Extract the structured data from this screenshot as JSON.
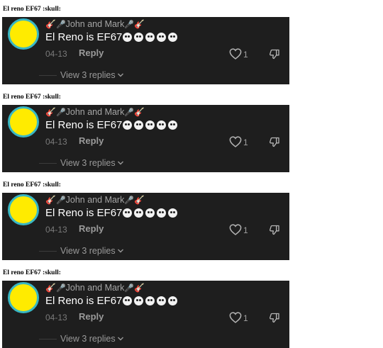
{
  "caption": "El reno EF67 :skull:",
  "comment": {
    "author_prefix_emoji": "🎸",
    "author_prefix_mic": "🎤",
    "author": "John and Mark",
    "author_suffix_mic": "🎤",
    "author_suffix_emoji": "🎸",
    "text": "El Reno is EF67",
    "skull_count": 5,
    "date": "04-13",
    "reply_label": "Reply",
    "like_count": "1",
    "view_replies_label": "View 3 replies"
  },
  "icons": {
    "like": "heart-outline-icon",
    "dislike": "thumbs-down-icon",
    "expand": "chevron-down-icon"
  },
  "colors": {
    "card_background": "#1e1e1e",
    "avatar_fill": "#ffeb00",
    "avatar_ring": "#38b7c4",
    "comment_text": "#ffffff",
    "secondary_text": "#9a9a9a"
  },
  "repeat_count": 4
}
